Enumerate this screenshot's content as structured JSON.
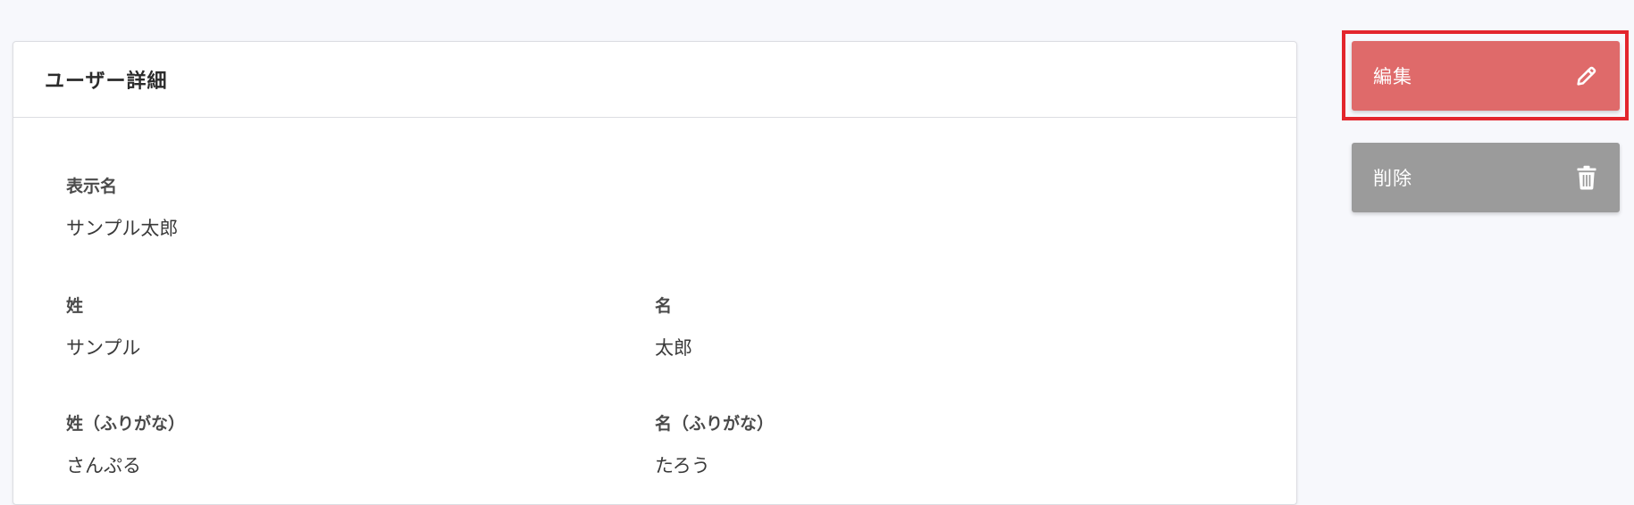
{
  "card": {
    "title": "ユーザー詳細"
  },
  "fields": {
    "display_name": {
      "label": "表示名",
      "value": "サンプル太郎"
    },
    "last_name": {
      "label": "姓",
      "value": "サンプル"
    },
    "first_name": {
      "label": "名",
      "value": "太郎"
    },
    "last_name_kana": {
      "label": "姓（ふりがな）",
      "value": "さんぷる"
    },
    "first_name_kana": {
      "label": "名（ふりがな）",
      "value": "たろう"
    }
  },
  "actions": {
    "edit": {
      "label": "編集",
      "icon": "pencil-icon",
      "color": "#df6a6a"
    },
    "delete": {
      "label": "削除",
      "icon": "trash-icon",
      "color": "#9b9b9b"
    }
  },
  "highlight": {
    "color": "#e3262d"
  }
}
